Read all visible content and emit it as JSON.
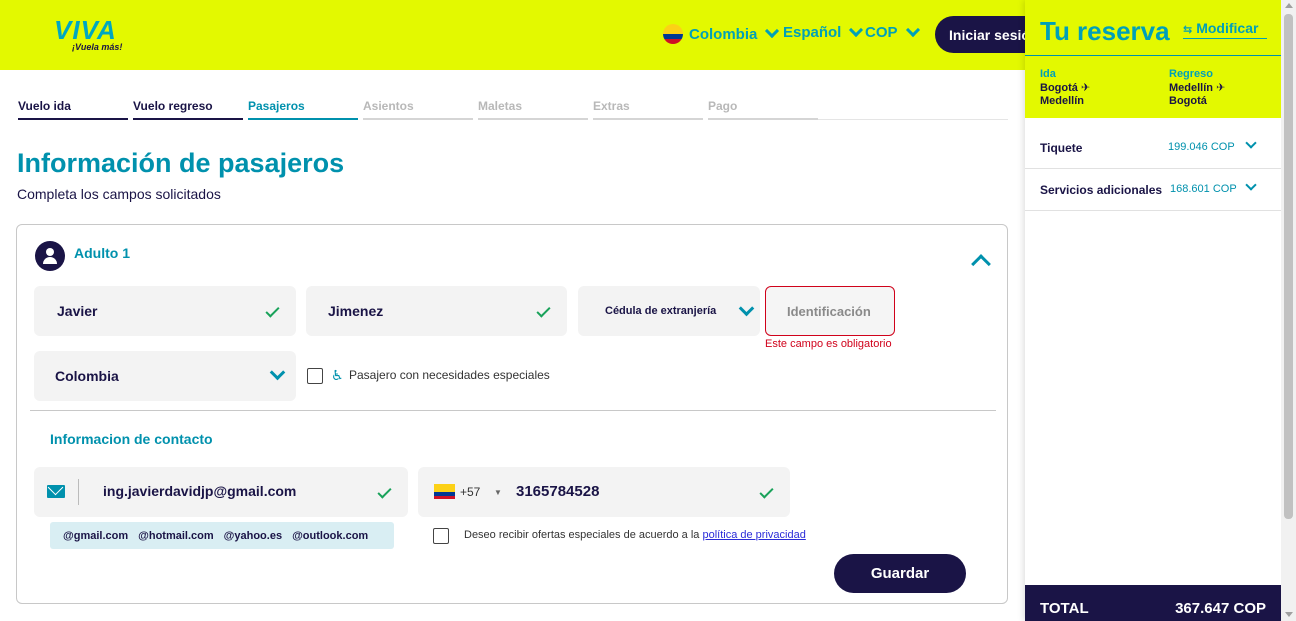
{
  "header": {
    "logo": "VIVA",
    "tagline": "¡Vuela más!",
    "country": "Colombia",
    "language": "Español",
    "currency": "COP",
    "login_label": "Iniciar sesión",
    "brand_color": "#e3f900",
    "accent_color": "#00a0b8",
    "dark_color": "#1a1446"
  },
  "steps": [
    "Vuelo ida",
    "Vuelo regreso",
    "Pasajeros",
    "Asientos",
    "Maletas",
    "Extras",
    "Pago"
  ],
  "page": {
    "title": "Información de pasajeros",
    "subtitle": "Completa los campos solicitados"
  },
  "passenger": {
    "title": "Adulto 1",
    "first_name": "Javier",
    "last_name": "Jimenez",
    "doc_type": "Cédula de extranjería",
    "id_placeholder": "Identificación",
    "id_error": "Este campo es obligatorio",
    "nationality": "Colombia",
    "special_needs_label": "Pasajero con necesidades especiales"
  },
  "contact": {
    "title": "Informacion de contacto",
    "email": "ing.javierdavidjp@gmail.com",
    "domains": [
      "@gmail.com",
      "@hotmail.com",
      "@yahoo.es",
      "@outlook.com"
    ],
    "phone_code": "+57",
    "phone": "3165784528",
    "offers_text": "Deseo recibir ofertas especiales de acuerdo a la ",
    "privacy_link": "política de privacidad",
    "save_label": "Guardar"
  },
  "summary": {
    "title": "Tu reserva",
    "modify_label": "Modificar",
    "outbound_label": "Ida",
    "outbound_from": "Bogotá",
    "outbound_to": "Medellín",
    "return_label": "Regreso",
    "return_from": "Medellín",
    "return_to": "Bogotá",
    "ticket_label": "Tiquete",
    "ticket_value": "199.046 COP",
    "extras_label": "Servicios adicionales",
    "extras_value": "168.601 COP",
    "total_label": "TOTAL",
    "total_value": "367.647 COP"
  }
}
